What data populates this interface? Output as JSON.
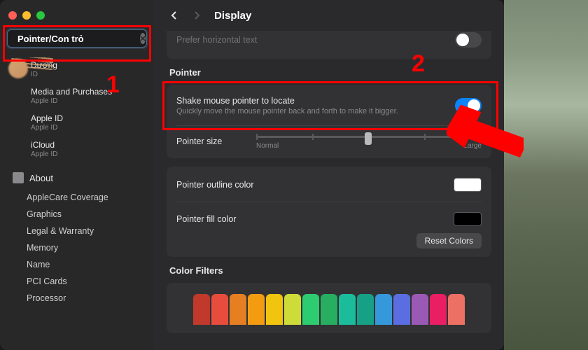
{
  "window": {
    "title": "Display"
  },
  "search": {
    "value": "Pointer/Con trỏ"
  },
  "sidebar": {
    "results": [
      {
        "title": "Dương",
        "sub": "ID"
      },
      {
        "title": "Media and Purchases",
        "sub": "Apple ID"
      },
      {
        "title": "Apple ID",
        "sub": "Apple ID"
      },
      {
        "title": "iCloud",
        "sub": "Apple ID"
      }
    ],
    "about_label": "About",
    "items": [
      "AppleCare Coverage",
      "Graphics",
      "Legal & Warranty",
      "Memory",
      "Name",
      "PCI Cards",
      "Processor"
    ]
  },
  "main": {
    "prefer_row": {
      "label": "Prefer horizontal text",
      "on": false
    },
    "section_pointer": "Pointer",
    "shake": {
      "label": "Shake mouse pointer to locate",
      "desc": "Quickly move the mouse pointer back and forth to make it bigger.",
      "on": true
    },
    "pointer_size": {
      "label": "Pointer size",
      "min": "Normal",
      "max": "Large"
    },
    "outline": {
      "label": "Pointer outline color",
      "color": "#ffffff"
    },
    "fill": {
      "label": "Pointer fill color",
      "color": "#000000"
    },
    "reset_label": "Reset Colors",
    "section_filters": "Color Filters",
    "crayon_colors": [
      "#c0392b",
      "#e74c3c",
      "#e67e22",
      "#f39c12",
      "#f1c40f",
      "#cddc39",
      "#2ecc71",
      "#27ae60",
      "#1abc9c",
      "#16a085",
      "#3498db",
      "#5b6ee1",
      "#9b59b6",
      "#e91e63",
      "#ec7063"
    ]
  },
  "annotations": {
    "n1": "1",
    "n2": "2"
  }
}
